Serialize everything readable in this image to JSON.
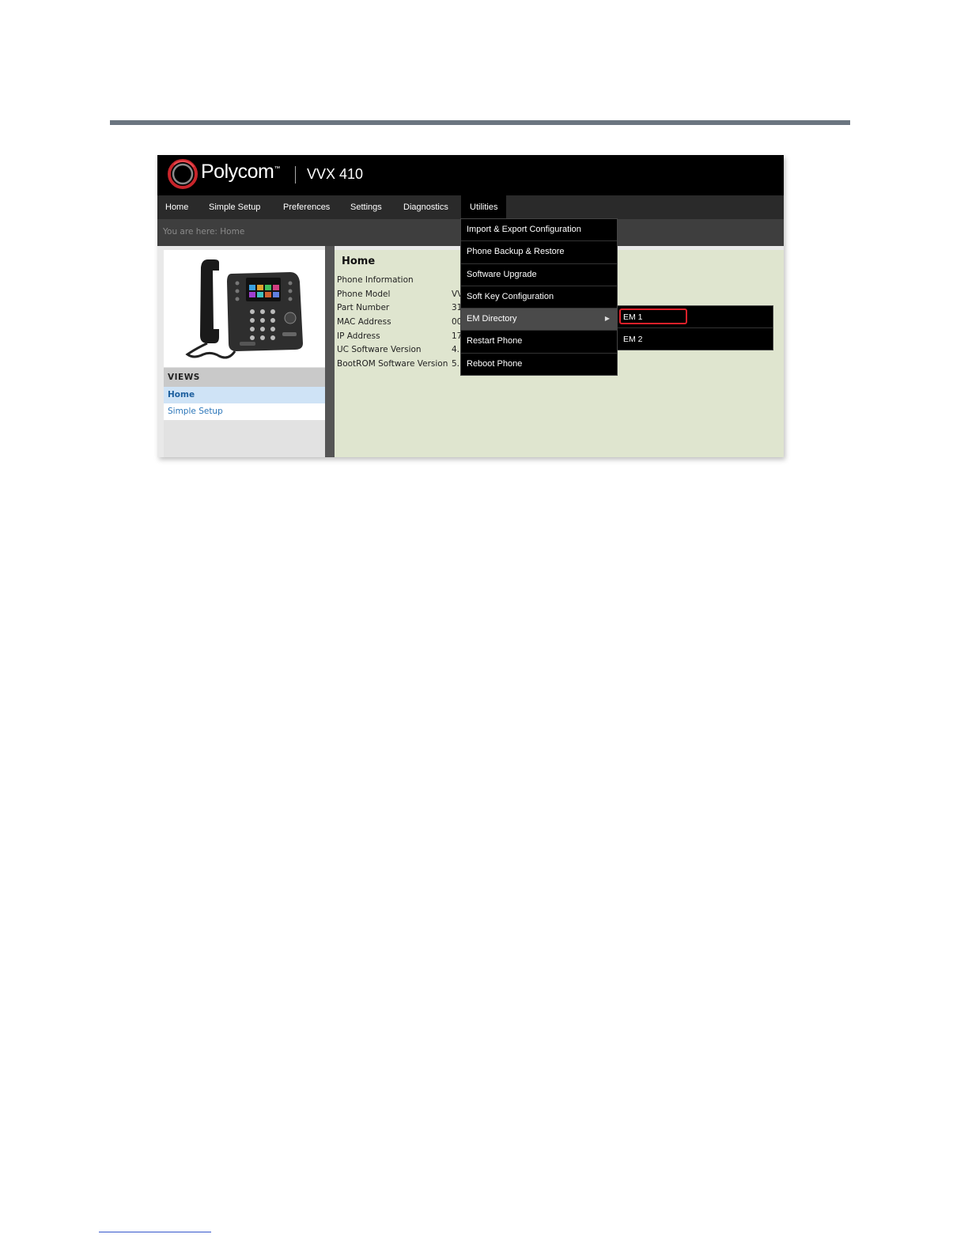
{
  "header": {
    "brand": "Polycom",
    "trademark": "™",
    "model": "VVX 410"
  },
  "nav": {
    "items": [
      "Home",
      "Simple Setup",
      "Preferences",
      "Settings",
      "Diagnostics",
      "Utilities"
    ],
    "active": "Utilities"
  },
  "breadcrumb": "You are here: Home",
  "views": {
    "title": "VIEWS",
    "items": [
      "Home",
      "Simple Setup"
    ],
    "active": "Home"
  },
  "main": {
    "title": "Home",
    "section": "Phone Information",
    "rows": [
      {
        "label": "Phone Model",
        "value": "VV"
      },
      {
        "label": "Part Number",
        "value": "31"
      },
      {
        "label": "MAC Address",
        "value": "00"
      },
      {
        "label": "IP Address",
        "value": "17"
      },
      {
        "label": "UC Software Version",
        "value": "4."
      },
      {
        "label": "BootROM Software Version",
        "value": "5."
      }
    ]
  },
  "utilities_menu": {
    "items": [
      "Import & Export Configuration",
      "Phone Backup & Restore",
      "Software Upgrade",
      "Soft Key Configuration",
      "EM Directory",
      "Restart Phone",
      "Reboot Phone"
    ],
    "hovered": "EM Directory",
    "submenu_arrow": "▶"
  },
  "em_submenu": {
    "items": [
      "EM 1",
      "EM 2"
    ],
    "highlighted": "EM 1"
  },
  "colors": {
    "highlight": "#e0202a",
    "link": "#2b76b9",
    "logo_red": "#c8252b"
  }
}
